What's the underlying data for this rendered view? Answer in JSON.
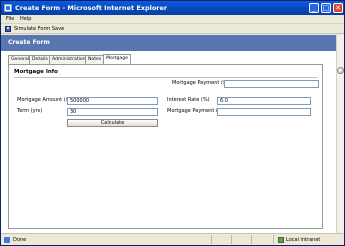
{
  "window": {
    "title": "Create Form - Microsoft Internet Explorer",
    "minimize_glyph": "_",
    "maximize_glyph": "□",
    "close_glyph": "✕"
  },
  "menu": {
    "items": [
      "File",
      "Help"
    ]
  },
  "toolbar": {
    "simulate_label": "Simulate Form Save"
  },
  "form": {
    "title": "Create Form",
    "tabs": [
      "General",
      "Details",
      "Administration",
      "Notes",
      "Mortgage"
    ],
    "active_tab": "Mortgage",
    "section_title": "Mortgage Info",
    "top_payment_label": "Mortgage Payment ($)",
    "top_payment_value": "",
    "amount_label": "Mortgage Amount ($)",
    "amount_value": "500000",
    "term_label": "Term (yrs)",
    "term_value": "30",
    "calculate_label": "Calculate",
    "rate_label": "Interest Rate (%)",
    "rate_value": "6.0",
    "payment_label": "Mortgage Payment ($)",
    "payment_value": ""
  },
  "status": {
    "text": "Done",
    "zone": "Local intranet"
  },
  "colors": {
    "title_bar": "#0a5ae2",
    "form_header": "#5a76b0",
    "chrome": "#ece9d8"
  }
}
